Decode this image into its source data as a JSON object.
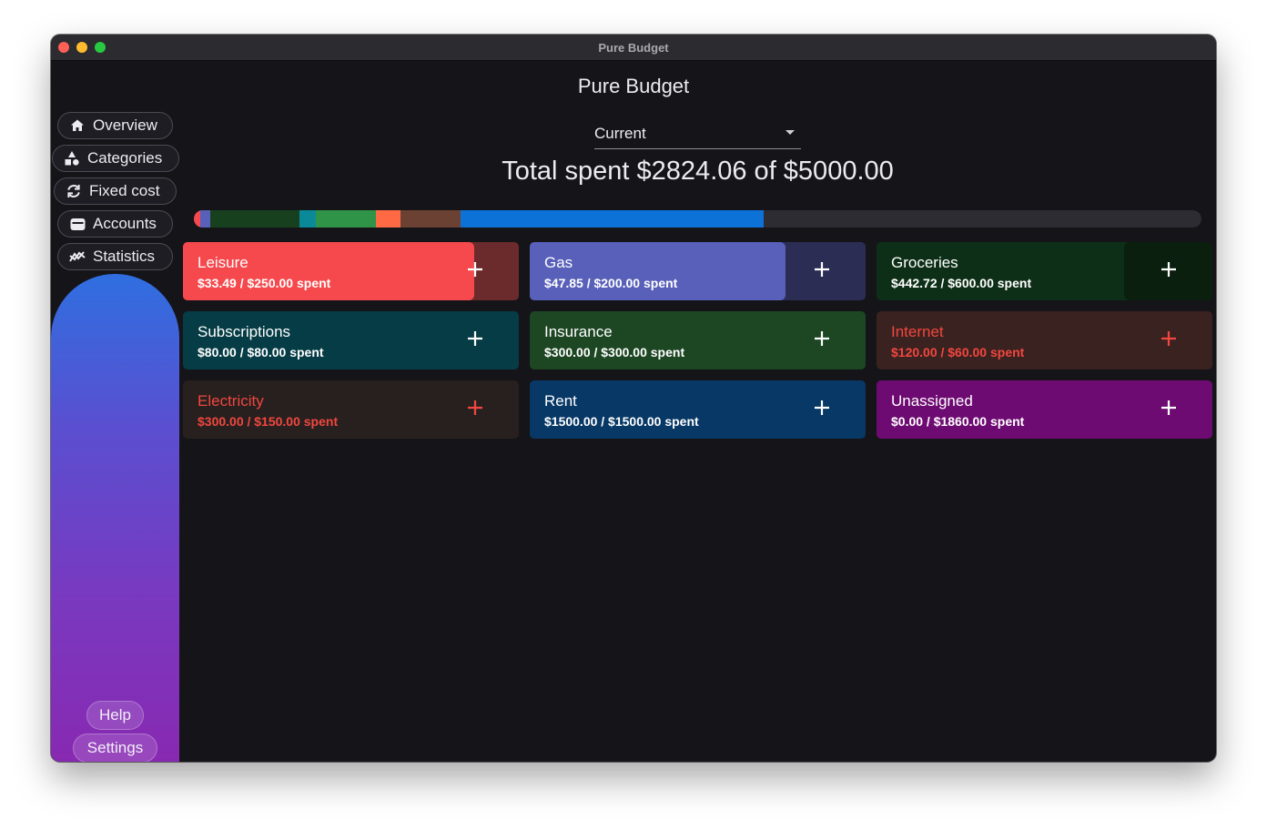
{
  "window": {
    "title": "Pure Budget"
  },
  "app": {
    "title": "Pure Budget"
  },
  "sidebar": {
    "items": [
      {
        "label": "Overview",
        "icon": "home-icon"
      },
      {
        "label": "Categories",
        "icon": "categories-icon"
      },
      {
        "label": "Fixed cost",
        "icon": "refresh-icon"
      },
      {
        "label": "Accounts",
        "icon": "wallet-icon"
      },
      {
        "label": "Statistics",
        "icon": "chart-line-icon"
      }
    ],
    "help_label": "Help",
    "settings_label": "Settings"
  },
  "period": {
    "selected": "Current"
  },
  "summary": {
    "total_text": "Total spent $2824.06 of $5000.00"
  },
  "colors": {
    "leisure": "#f5494d",
    "gas": "#5860ba",
    "groceries": "#0e2f17",
    "subscriptions": "#053c45",
    "insurance": "#1d4623",
    "internet": "#3a2220",
    "electricity": "#27201f",
    "rent": "#083866",
    "unassigned": "#6e0b72",
    "overspent_text": "#f2473f"
  },
  "progress_bar": {
    "total": 5000,
    "segments": [
      {
        "category": "Leisure",
        "value": 33.49,
        "color": "#f5494d"
      },
      {
        "category": "Gas",
        "value": 47.85,
        "color": "#5860ba"
      },
      {
        "category": "Groceries",
        "value": 442.72,
        "color": "#17401f"
      },
      {
        "category": "Subscriptions",
        "value": 80.0,
        "color": "#0a8a98"
      },
      {
        "category": "Insurance",
        "value": 300.0,
        "color": "#2f9447"
      },
      {
        "category": "Internet",
        "value": 120.0,
        "color": "#ff6a45"
      },
      {
        "category": "Electricity",
        "value": 300.0,
        "color": "#6b4134"
      },
      {
        "category": "Rent",
        "value": 1500.0,
        "color": "#0d72d8"
      }
    ]
  },
  "categories": [
    {
      "name": "Leisure",
      "spent_text": "$33.49 / $250.00 spent",
      "spent": 33.49,
      "budget": 250.0,
      "bg": "#6b2a2c",
      "fill": "#f5494d",
      "fill_fraction": 0.866,
      "text": "#ffffff",
      "overspent": false
    },
    {
      "name": "Gas",
      "spent_text": "$47.85 / $200.00 spent",
      "spent": 47.85,
      "budget": 200.0,
      "bg": "#2c2d55",
      "fill": "#5860ba",
      "fill_fraction": 0.761,
      "text": "#ffffff",
      "overspent": false
    },
    {
      "name": "Groceries",
      "spent_text": "$442.72 / $600.00 spent",
      "spent": 442.72,
      "budget": 600.0,
      "bg": "#0e2f17",
      "fill": "#0a1f0e",
      "fill_fraction": 0.262,
      "fill_side": "right",
      "text": "#ffffff",
      "overspent": false
    },
    {
      "name": "Subscriptions",
      "spent_text": "$80.00 / $80.00 spent",
      "spent": 80.0,
      "budget": 80.0,
      "bg": "#053c45",
      "fill": "#053c45",
      "fill_fraction": 0,
      "text": "#ffffff",
      "overspent": false
    },
    {
      "name": "Insurance",
      "spent_text": "$300.00 / $300.00 spent",
      "spent": 300.0,
      "budget": 300.0,
      "bg": "#1d4623",
      "fill": "#1d4623",
      "fill_fraction": 0,
      "text": "#ffffff",
      "overspent": false
    },
    {
      "name": "Internet",
      "spent_text": "$120.00 / $60.00 spent",
      "spent": 120.0,
      "budget": 60.0,
      "bg": "#3a2220",
      "fill": "#3a2220",
      "fill_fraction": 0,
      "text": "#f2473f",
      "overspent": true
    },
    {
      "name": "Electricity",
      "spent_text": "$300.00 / $150.00 spent",
      "spent": 300.0,
      "budget": 150.0,
      "bg": "#27201f",
      "fill": "#27201f",
      "fill_fraction": 0,
      "text": "#f2473f",
      "overspent": true
    },
    {
      "name": "Rent",
      "spent_text": "$1500.00 / $1500.00 spent",
      "spent": 1500.0,
      "budget": 1500.0,
      "bg": "#083866",
      "fill": "#083866",
      "fill_fraction": 0,
      "text": "#ffffff",
      "overspent": false
    },
    {
      "name": "Unassigned",
      "spent_text": "$0.00 / $1860.00 spent",
      "spent": 0.0,
      "budget": 1860.0,
      "bg": "#6e0b72",
      "fill": "#6e0b72",
      "fill_fraction": 0,
      "text": "#ffffff",
      "overspent": false
    }
  ]
}
